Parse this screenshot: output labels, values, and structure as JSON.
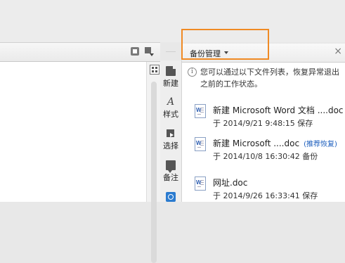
{
  "panel": {
    "title": "备份管理",
    "close": "×",
    "info": "您可以通过以下文件列表，恢复异常退出之前的工作状态。"
  },
  "sidebar": {
    "items": [
      {
        "label": "新建",
        "icon": "new-doc-icon"
      },
      {
        "label": "样式",
        "icon": "style-icon"
      },
      {
        "label": "选择",
        "icon": "select-icon"
      },
      {
        "label": "备注",
        "icon": "note-icon"
      },
      {
        "label": "",
        "icon": "backup-icon"
      }
    ]
  },
  "backups": [
    {
      "name": "新建 Microsoft Word 文档 ....doc",
      "meta": "于 2014/9/21 9:48:15 保存",
      "recommend": ""
    },
    {
      "name": "新建 Microsoft ....doc",
      "meta": "于 2014/10/8 16:30:42 备份",
      "recommend": "(推荐恢复)"
    },
    {
      "name": "网址.doc",
      "meta": "于 2014/9/26 16:33:41 保存",
      "recommend": ""
    }
  ],
  "colors": {
    "highlight": "#f08a24",
    "accent": "#1a5dbd"
  }
}
